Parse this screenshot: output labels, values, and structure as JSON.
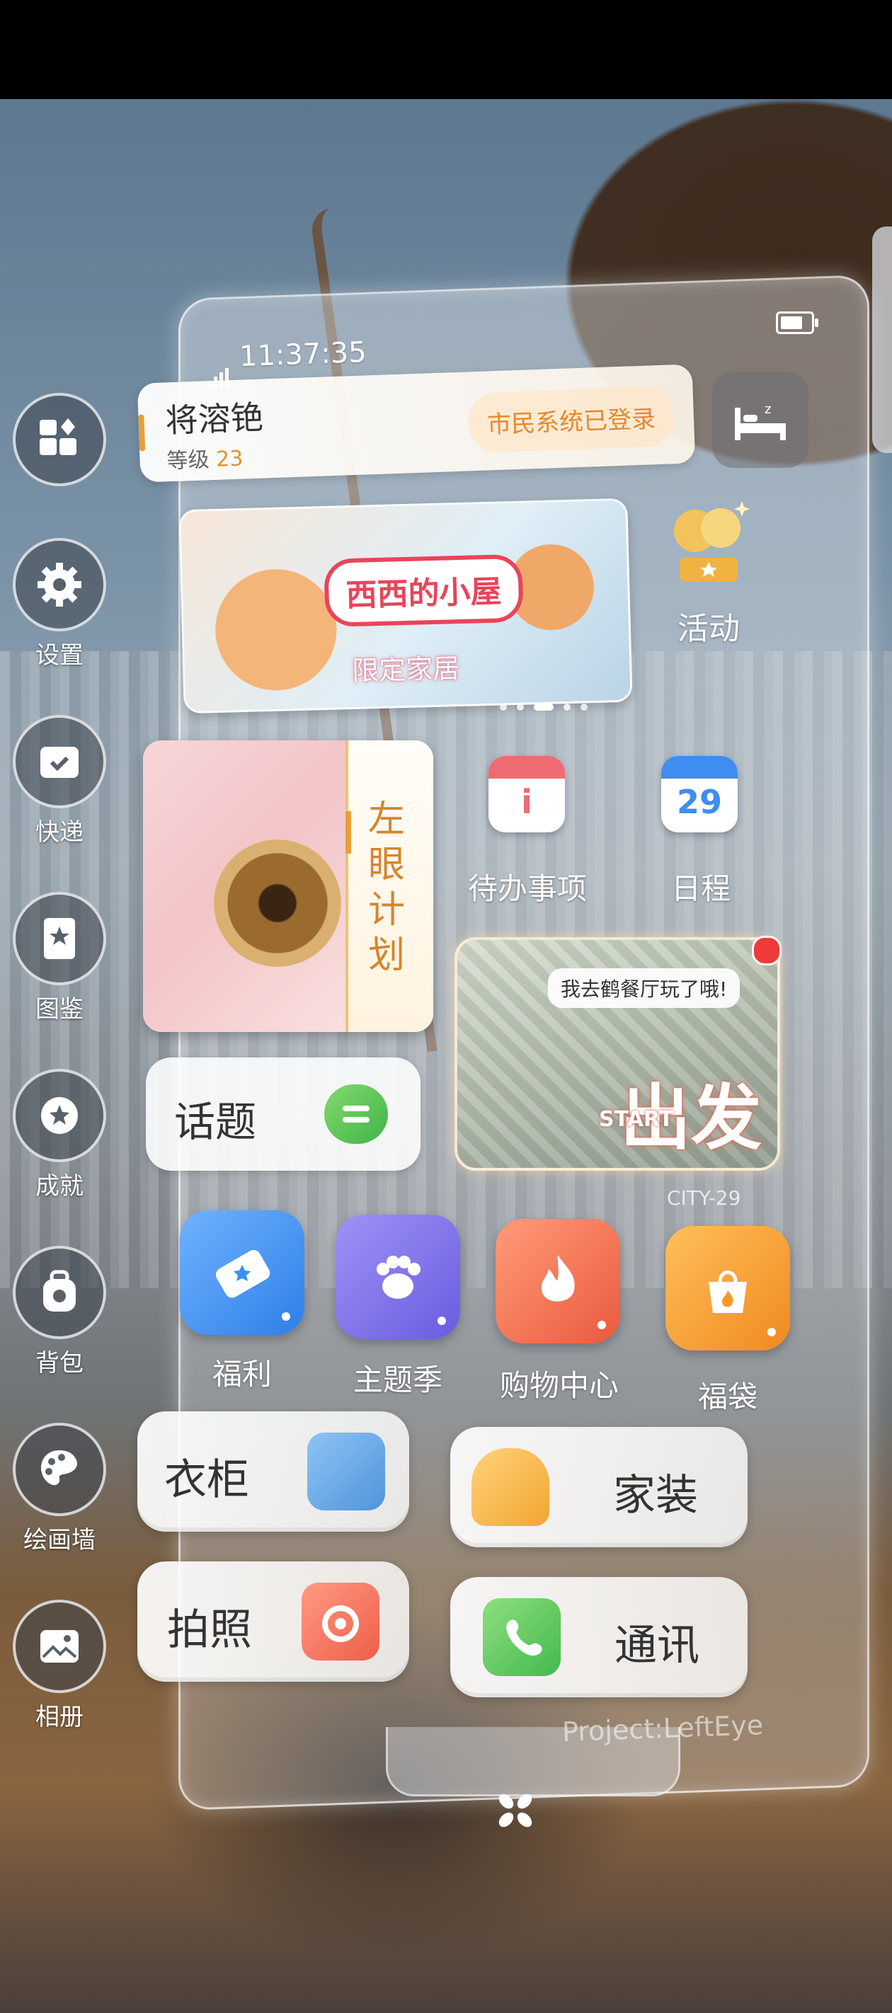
{
  "status": {
    "time": "11:37:35"
  },
  "user": {
    "name": "将溶铯",
    "level_label": "等级",
    "level_value": "23",
    "login_status": "市民系统已登录"
  },
  "banner": {
    "logo_text": "西西的小屋",
    "tag": "限定家居"
  },
  "activity_label": "活动",
  "left_eye_plan": "左眼计划",
  "todo": {
    "label": "待办事项",
    "icon": "todo-icon"
  },
  "calendar": {
    "label": "日程",
    "day": "29"
  },
  "topic_label": "话题",
  "city_card": {
    "message": "我去鹤餐厅玩了哦!",
    "go_text": "出发",
    "start_text": "START",
    "city_label": "CITY-29"
  },
  "apps": [
    {
      "label": "福利",
      "color": "#3c8ff0"
    },
    {
      "label": "主题季",
      "color": "#7b6ee8"
    },
    {
      "label": "购物中心",
      "color": "#f26a4e"
    },
    {
      "label": "福袋",
      "color": "#f39a2a"
    }
  ],
  "bottom_buttons": {
    "wardrobe": "衣柜",
    "home_decor": "家装",
    "photo": "拍照",
    "contact": "通讯"
  },
  "sidebar": [
    "设置",
    "快递",
    "图鉴",
    "成就",
    "背包",
    "绘画墙",
    "相册"
  ],
  "footer": {
    "project": "Project:LeftEye"
  }
}
